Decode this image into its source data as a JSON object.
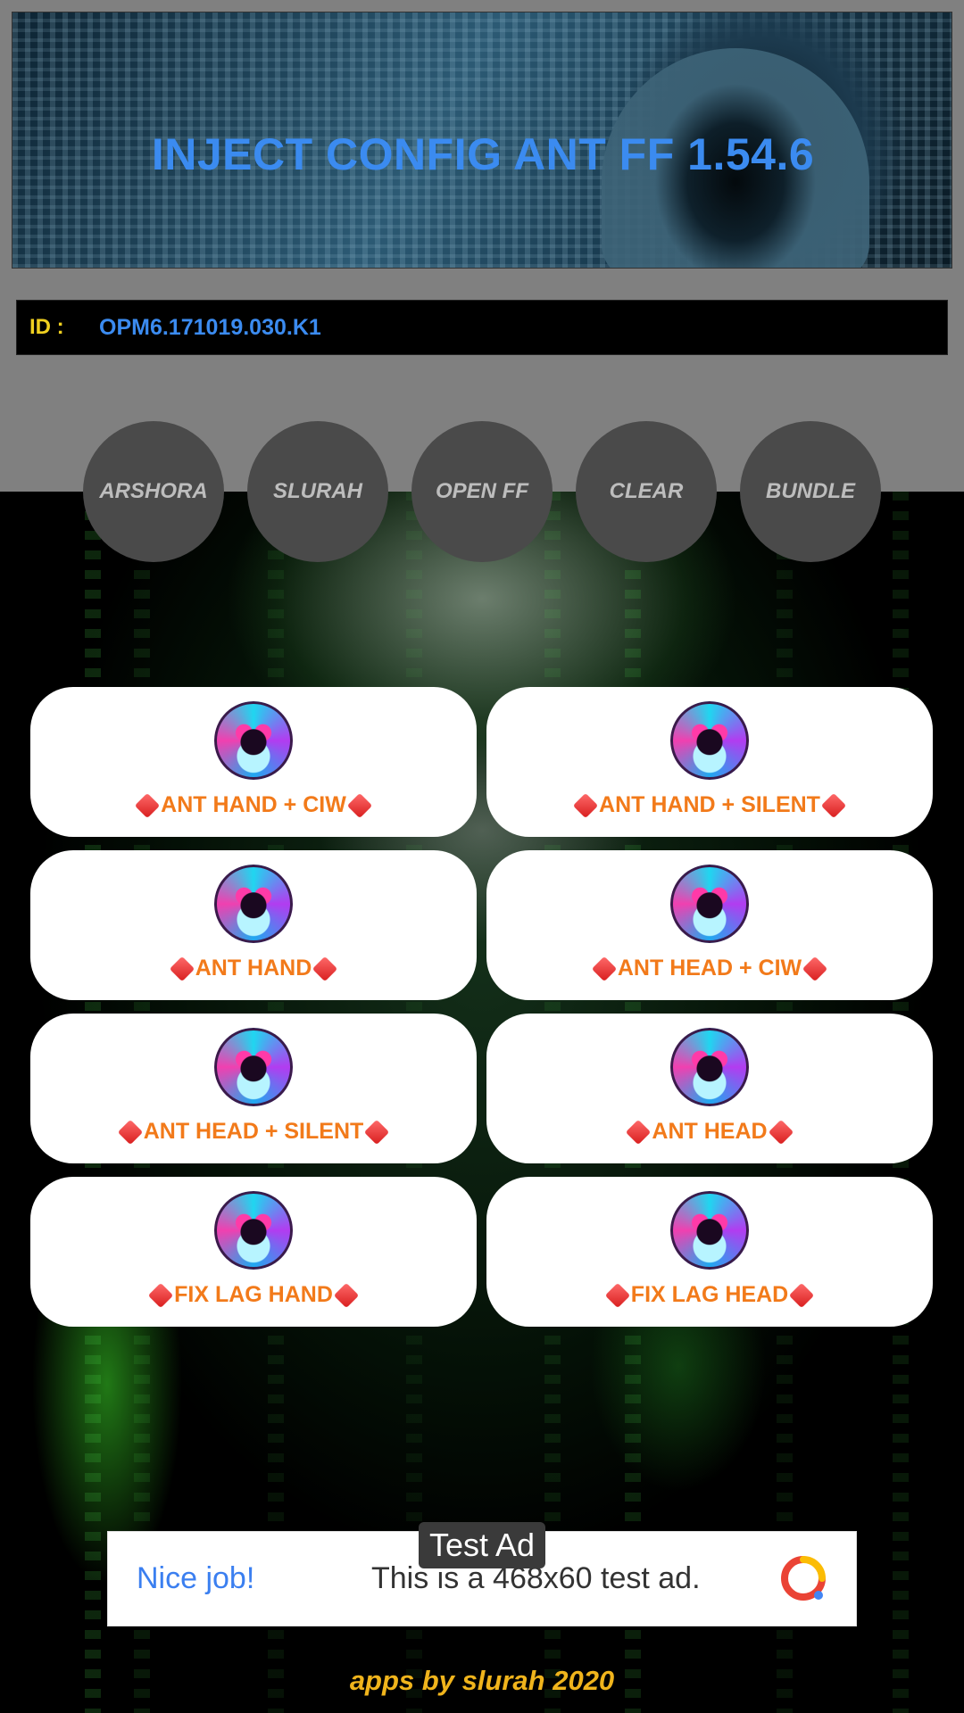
{
  "banner": {
    "title": "INJECT CONFIG ANT FF 1.54.6"
  },
  "device": {
    "id_label": "ID :",
    "id_value": "OPM6.171019.030.K1"
  },
  "top_buttons": [
    "ARSHORA",
    "SLURAH",
    "OPEN FF",
    "CLEAR",
    "BUNDLE"
  ],
  "cards": [
    {
      "label": "ANT HAND + CIW"
    },
    {
      "label": "ANT HAND + SILENT"
    },
    {
      "label": "ANT HAND"
    },
    {
      "label": "ANT HEAD + CIW"
    },
    {
      "label": "ANT HEAD + SILENT"
    },
    {
      "label": "ANT HEAD"
    },
    {
      "label": "FIX LAG HAND"
    },
    {
      "label": "FIX LAG HEAD"
    }
  ],
  "ad": {
    "tag": "Test Ad",
    "headline": "Nice job!",
    "body": "This is a 468x60 test ad."
  },
  "footer": "apps by slurah 2020",
  "colors": {
    "title_blue": "#3b8bf0",
    "card_text_orange": "#f27a1a",
    "footer_gold": "#f0b41c",
    "id_label_yellow": "#f0d020",
    "circle_gray": "#4a4a4a"
  }
}
